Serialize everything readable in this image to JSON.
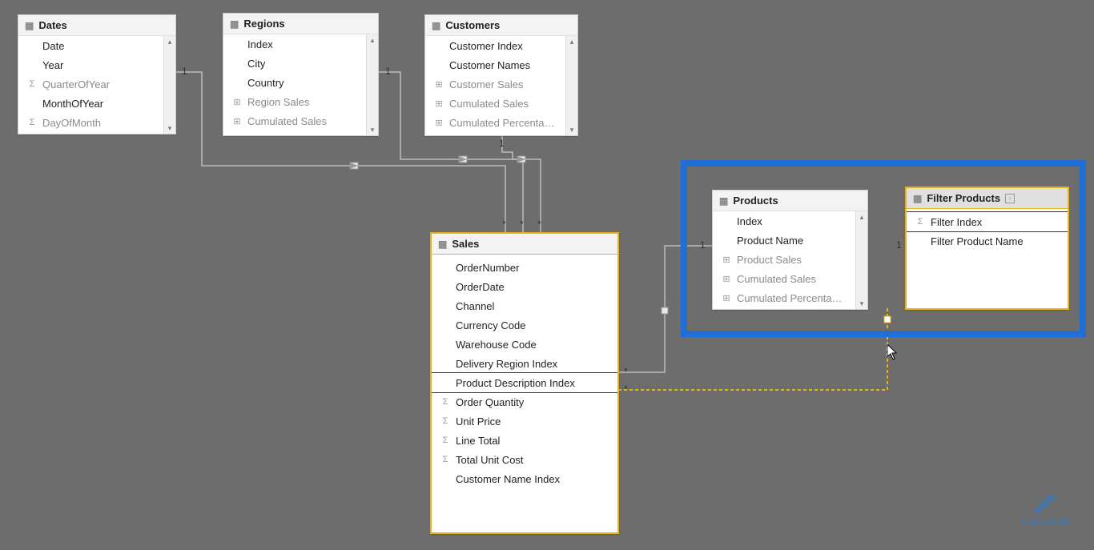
{
  "tables": {
    "dates": {
      "title": "Dates",
      "fields": [
        {
          "label": "Date",
          "icon": ""
        },
        {
          "label": "Year",
          "icon": ""
        },
        {
          "label": "QuarterOfYear",
          "icon": "Σ",
          "measure": true
        },
        {
          "label": "MonthOfYear",
          "icon": ""
        },
        {
          "label": "DayOfMonth",
          "icon": "Σ",
          "measure": true
        }
      ]
    },
    "regions": {
      "title": "Regions",
      "fields": [
        {
          "label": "Index",
          "icon": ""
        },
        {
          "label": "City",
          "icon": ""
        },
        {
          "label": "Country",
          "icon": ""
        },
        {
          "label": "Region Sales",
          "icon": "⊞",
          "measure": true
        },
        {
          "label": "Cumulated Sales",
          "icon": "⊞",
          "measure": true
        }
      ]
    },
    "customers": {
      "title": "Customers",
      "fields": [
        {
          "label": "Customer Index",
          "icon": ""
        },
        {
          "label": "Customer Names",
          "icon": ""
        },
        {
          "label": "Customer Sales",
          "icon": "⊞",
          "measure": true
        },
        {
          "label": "Cumulated Sales",
          "icon": "⊞",
          "measure": true
        },
        {
          "label": "Cumulated Percenta…",
          "icon": "⊞",
          "measure": true
        }
      ]
    },
    "sales": {
      "title": "Sales",
      "fields": [
        {
          "label": "OrderNumber",
          "icon": ""
        },
        {
          "label": "OrderDate",
          "icon": ""
        },
        {
          "label": "Channel",
          "icon": ""
        },
        {
          "label": "Currency Code",
          "icon": ""
        },
        {
          "label": "Warehouse Code",
          "icon": ""
        },
        {
          "label": "Delivery Region Index",
          "icon": ""
        },
        {
          "label": "Product Description Index",
          "icon": "",
          "selected": true
        },
        {
          "label": "Order Quantity",
          "icon": "Σ"
        },
        {
          "label": "Unit Price",
          "icon": "Σ"
        },
        {
          "label": "Line Total",
          "icon": "Σ"
        },
        {
          "label": "Total Unit Cost",
          "icon": "Σ"
        },
        {
          "label": "Customer Name Index",
          "icon": ""
        }
      ]
    },
    "products": {
      "title": "Products",
      "fields": [
        {
          "label": "Index",
          "icon": ""
        },
        {
          "label": "Product Name",
          "icon": ""
        },
        {
          "label": "Product Sales",
          "icon": "⊞",
          "measure": true
        },
        {
          "label": "Cumulated Sales",
          "icon": "⊞",
          "measure": true
        },
        {
          "label": "Cumulated Percenta…",
          "icon": "⊞",
          "measure": true
        }
      ]
    },
    "filter_products": {
      "title": "Filter Products",
      "fields": [
        {
          "label": "Filter Index",
          "icon": "Σ",
          "selected": true
        },
        {
          "label": "Filter Product Name",
          "icon": ""
        }
      ]
    }
  },
  "cardinality": {
    "one": "1",
    "many": "*"
  },
  "watermark": "SUBSCRIBE"
}
